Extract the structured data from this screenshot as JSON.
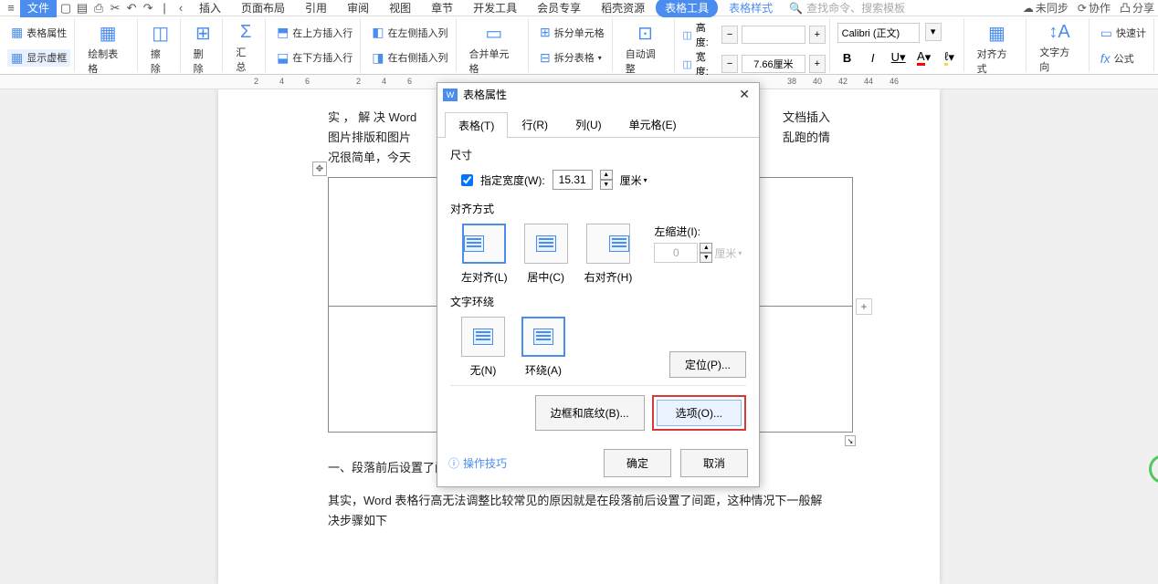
{
  "menubar": {
    "file": "文件",
    "items": [
      "插入",
      "页面布局",
      "引用",
      "审阅",
      "视图",
      "章节",
      "开发工具",
      "会员专享",
      "稻壳资源"
    ],
    "tool_tab": "表格工具",
    "style_tab": "表格样式",
    "search_placeholder": "查找命令、搜索模板",
    "unsync": "未同步",
    "collab": "协作",
    "share": "分享"
  },
  "ribbon": {
    "table_props": "表格属性",
    "show_dashed": "显示虚框",
    "draw_table": "绘制表格",
    "erase": "擦除",
    "delete": "删除",
    "summary": "汇总",
    "ins_above": "在上方插入行",
    "ins_below": "在下方插入行",
    "ins_left": "在左侧插入列",
    "ins_right": "在右侧插入列",
    "merge": "合并单元格",
    "split_cell": "拆分单元格",
    "split_table": "拆分表格",
    "autofit": "自动调整",
    "height_label": "高度:",
    "width_label": "宽度:",
    "width_value": "7.66厘米",
    "font": "Calibri (正文)",
    "align": "对齐方式",
    "text_dir": "文字方向",
    "fast": "快速计",
    "formula": "公式"
  },
  "ruler": {
    "marks": [
      "2",
      "4",
      "6",
      "2",
      "4",
      "6",
      "38",
      "40",
      "42",
      "44",
      "46"
    ]
  },
  "doc": {
    "line1a": "实 ， 解 决  Word",
    "line1b": "文档插入",
    "line2a": "图片排版和图片",
    "line2b": "乱跑的情",
    "line3": "况很简单，今天",
    "h1": "一、段落前后设置了间距",
    "p1": "其实，Word 表格行高无法调整比较常见的原因就是在段落前后设置了间距，这种情况下一般解决步骤如下"
  },
  "dialog": {
    "title": "表格属性",
    "tabs": {
      "table": "表格(T)",
      "row": "行(R)",
      "col": "列(U)",
      "cell": "单元格(E)"
    },
    "size_label": "尺寸",
    "spec_width": "指定宽度(W):",
    "width_value": "15.31",
    "unit": "厘米",
    "align_label": "对齐方式",
    "align_left": "左对齐(L)",
    "align_center": "居中(C)",
    "align_right": "右对齐(H)",
    "indent_label": "左缩进(I):",
    "indent_value": "0",
    "indent_unit": "厘米",
    "wrap_label": "文字环绕",
    "wrap_none": "无(N)",
    "wrap_around": "环绕(A)",
    "btn_pos": "定位(P)...",
    "btn_border": "边框和底纹(B)...",
    "btn_options": "选项(O)...",
    "tips": "操作技巧",
    "ok": "确定",
    "cancel": "取消"
  }
}
